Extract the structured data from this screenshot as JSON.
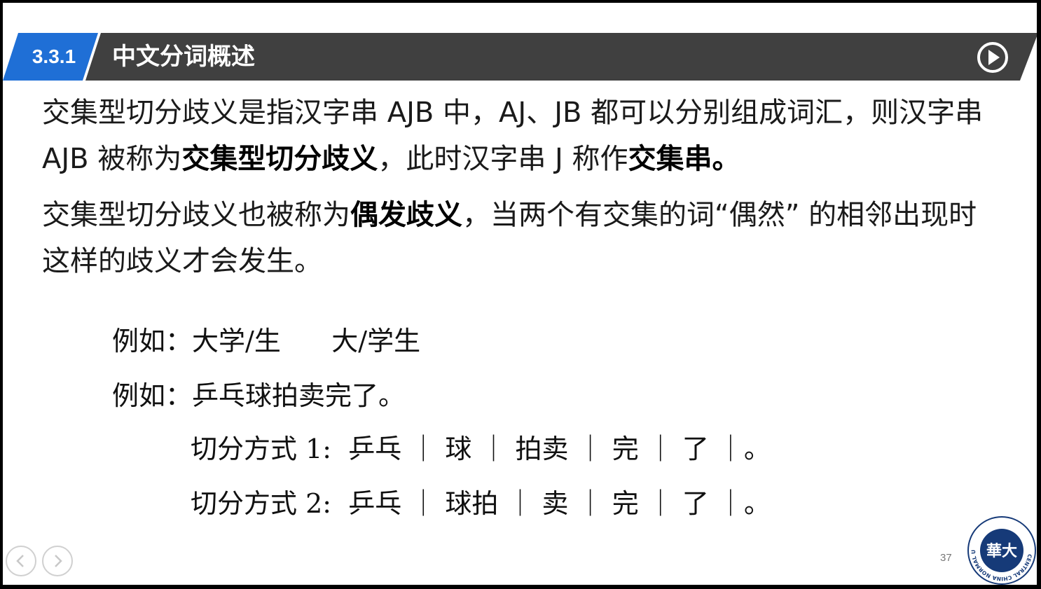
{
  "header": {
    "section_number": "3.3.1",
    "title": "中文分词概述"
  },
  "content": {
    "para1": [
      {
        "text": "交集型切分歧义是指汉字串 AJB 中，AJ、JB 都可以分别组成词汇，则汉字串 AJB 被称为",
        "bold": false
      },
      {
        "text": "交集型切分歧义",
        "bold": true
      },
      {
        "text": "，此时汉字串 J 称作",
        "bold": false
      },
      {
        "text": "交集串。",
        "bold": true
      }
    ],
    "para2": [
      {
        "text": "交集型切分歧义也被称为",
        "bold": false
      },
      {
        "text": "偶发歧义",
        "bold": true
      },
      {
        "text": "，当两个有交集的词“偶然” 的相邻出现时这样的歧义才会发生。",
        "bold": false
      }
    ]
  },
  "examples": {
    "ex1_label": "例如：",
    "ex1_text": "大学/生      大/学生",
    "ex2_label": "例如：",
    "ex2_text": "乒乓球拍卖完了。",
    "seg1": "切分方式 1:  乒乓 ｜ 球 ｜ 拍卖 ｜ 完 ｜ 了 ｜。",
    "seg2": "切分方式 2:  乒乓 ｜ 球拍 ｜ 卖 ｜ 完 ｜ 了 ｜。"
  },
  "footer": {
    "page_number": "37",
    "logo_text": "CENTRAL CHINA NORMAL UNIVERSITY",
    "logo_glyph": "華大"
  },
  "colors": {
    "accent": "#1f6fd6",
    "header_bg": "#404040",
    "logo": "#163a78"
  },
  "icons": {
    "play": "play-circle-icon",
    "prev": "chevron-left-icon",
    "next": "chevron-right-icon"
  }
}
